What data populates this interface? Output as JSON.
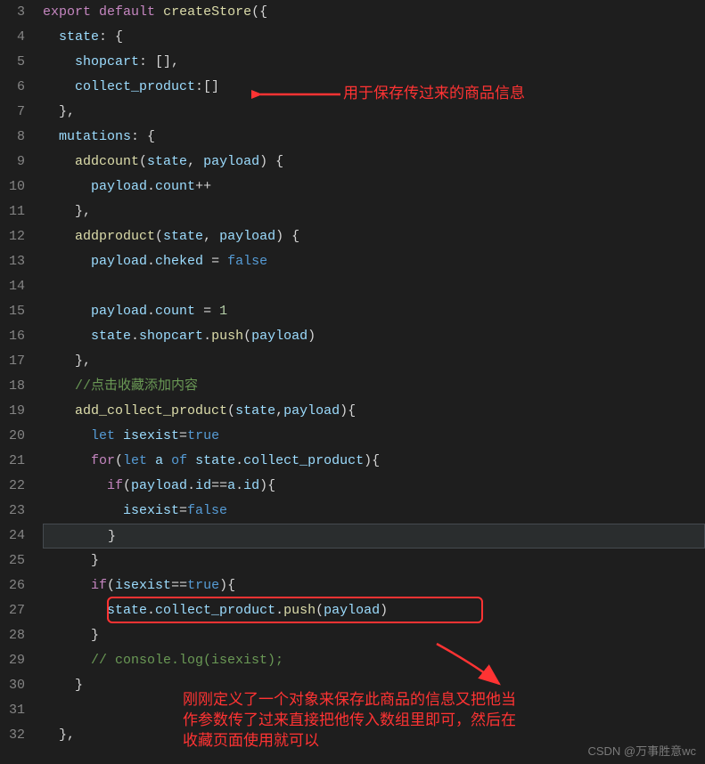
{
  "lineNumbers": [
    "3",
    "4",
    "5",
    "6",
    "7",
    "8",
    "9",
    "10",
    "11",
    "12",
    "13",
    "14",
    "15",
    "16",
    "17",
    "18",
    "19",
    "20",
    "21",
    "22",
    "23",
    "24",
    "25",
    "26",
    "27",
    "28",
    "29",
    "30",
    "31",
    "32"
  ],
  "code": {
    "l3": {
      "kw": "export",
      "kw2": "default",
      "fn": "createStore",
      "p1": "({"
    },
    "l4": {
      "prop": "state",
      "p1": ": {"
    },
    "l5": {
      "prop": "shopcart",
      "p1": ": [],"
    },
    "l6": {
      "prop": "collect_product",
      "p1": ":[]"
    },
    "l7": {
      "p1": "},"
    },
    "l8": {
      "prop": "mutations",
      "p1": ": {"
    },
    "l9": {
      "fn": "addcount",
      "p1": "(",
      "a1": "state",
      "p2": ", ",
      "a2": "payload",
      "p3": ") {"
    },
    "l10": {
      "v": "payload",
      "p1": ".",
      "prop": "count",
      "p2": "++"
    },
    "l11": {
      "p1": "},"
    },
    "l12": {
      "fn": "addproduct",
      "p1": "(",
      "a1": "state",
      "p2": ", ",
      "a2": "payload",
      "p3": ") {"
    },
    "l13": {
      "v": "payload",
      "p1": ".",
      "prop": "cheked",
      "p2": " = ",
      "bool": "false"
    },
    "l14": {
      "blank": ""
    },
    "l15": {
      "v": "payload",
      "p1": ".",
      "prop": "count",
      "p2": " = ",
      "num": "1"
    },
    "l16": {
      "v": "state",
      "p1": ".",
      "prop": "shopcart",
      "p2": ".",
      "fn": "push",
      "p3": "(",
      "a1": "payload",
      "p4": ")"
    },
    "l17": {
      "p1": "},"
    },
    "l18": {
      "comment": "//点击收藏添加内容"
    },
    "l19": {
      "fn": "add_collect_product",
      "p1": "(",
      "a1": "state",
      "p2": ",",
      "a2": "payload",
      "p3": "){"
    },
    "l20": {
      "kw": "let",
      "v": " isexist",
      "p1": "=",
      "bool": "true"
    },
    "l21": {
      "kw": "for",
      "p1": "(",
      "kw2": "let",
      "v": " a ",
      "kw3": "of",
      "v2": " state",
      "p2": ".",
      "prop": "collect_product",
      "p3": "){"
    },
    "l22": {
      "kw": "if",
      "p1": "(",
      "v": "payload",
      "p2": ".",
      "prop": "id",
      "p3": "==",
      "v2": "a",
      "p4": ".",
      "prop2": "id",
      "p5": "){"
    },
    "l23": {
      "v": "isexist",
      "p1": "=",
      "bool": "false"
    },
    "l24": {
      "p1": "}"
    },
    "l25": {
      "p1": "}"
    },
    "l26": {
      "kw": "if",
      "p1": "(",
      "v": "isexist",
      "p2": "==",
      "bool": "true",
      "p3": "){"
    },
    "l27": {
      "v": "state",
      "p1": ".",
      "prop": "collect_product",
      "p2": ".",
      "fn": "push",
      "p3": "(",
      "a1": "payload",
      "p4": ")"
    },
    "l28": {
      "p1": "}"
    },
    "l29": {
      "comment": "// console.log(isexist);"
    },
    "l30": {
      "p1": "}"
    },
    "l31": {
      "blank": ""
    },
    "l32": {
      "p1": "},"
    }
  },
  "annotations": {
    "a1": "用于保存传过来的商品信息",
    "a2_l1": "刚刚定义了一个对象来保存此商品的信息又把他当",
    "a2_l2": "作参数传了过来直接把他传入数组里即可，然后在",
    "a2_l3": "收藏页面使用就可以"
  },
  "watermark": "CSDN @万事胜意wc"
}
